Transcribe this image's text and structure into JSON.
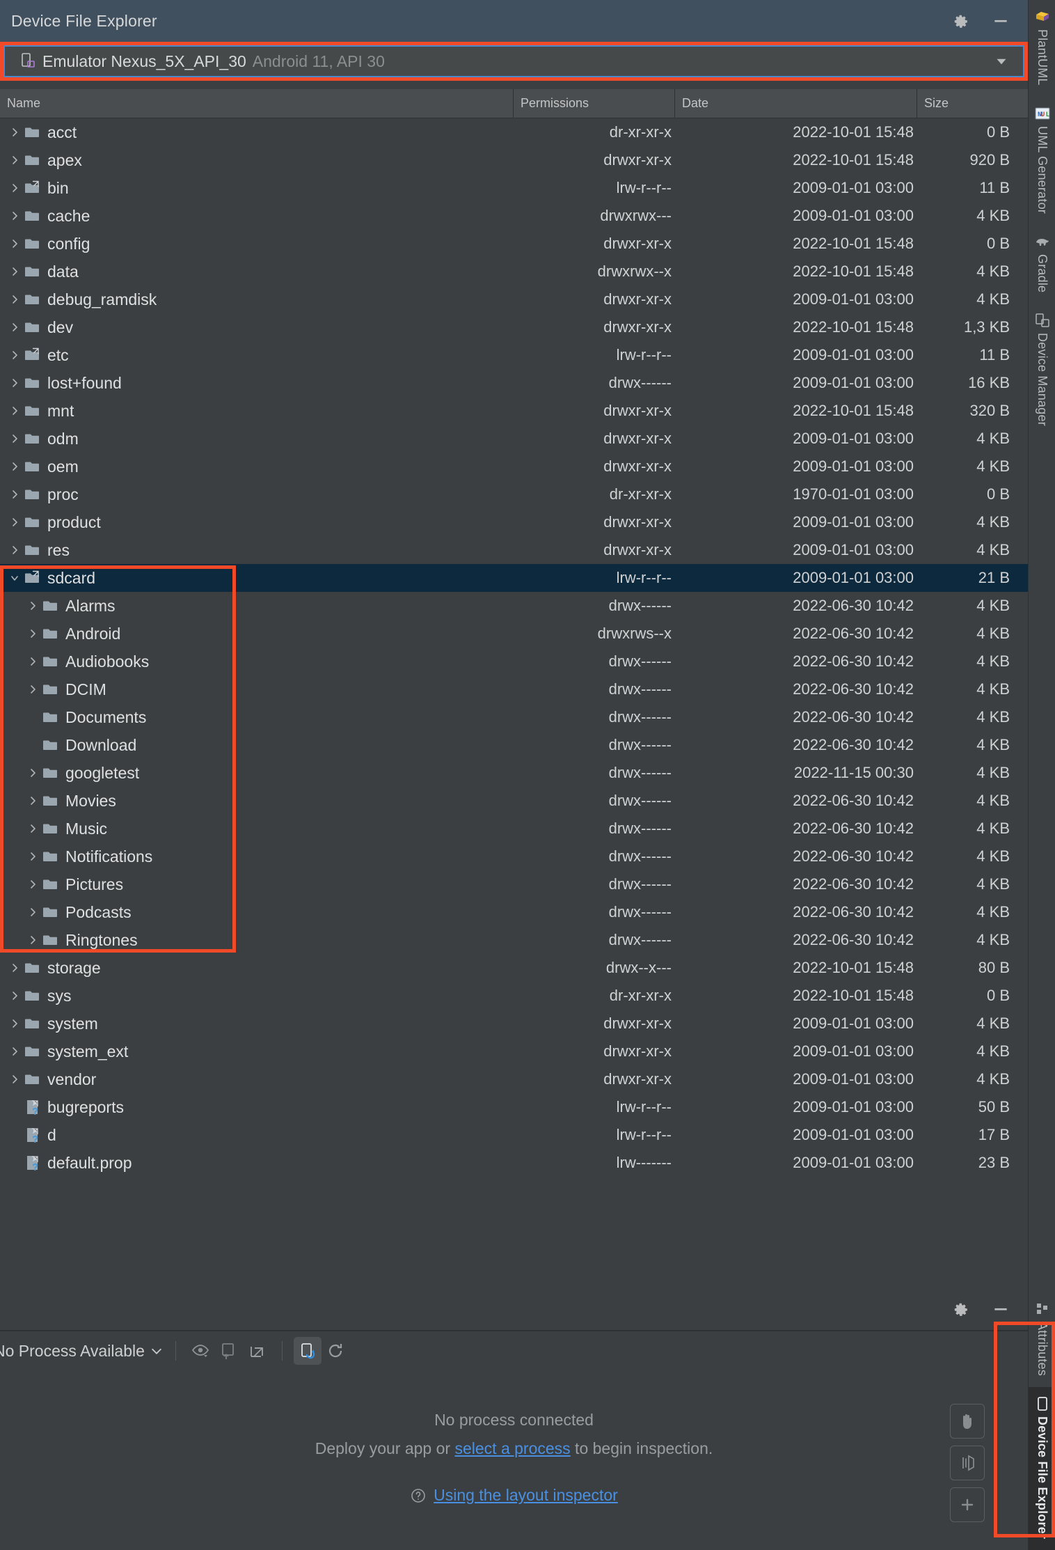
{
  "window": {
    "title": "Device File Explorer",
    "settings_icon": "gear-icon",
    "minimize_icon": "minimize-icon"
  },
  "device_selector": {
    "icon": "device-phone-icon",
    "name": "Emulator Nexus_5X_API_30",
    "subtitle": "Android 11, API 30",
    "caret_icon": "chevron-down-icon"
  },
  "table": {
    "columns": [
      "Name",
      "Permissions",
      "Date",
      "Size"
    ],
    "rows": [
      {
        "name": "acct",
        "indent": 0,
        "twisty": "collapsed",
        "icon": "folder",
        "permissions": "dr-xr-xr-x",
        "date": "2022-10-01 15:48",
        "size": "0 B",
        "selected": false
      },
      {
        "name": "apex",
        "indent": 0,
        "twisty": "collapsed",
        "icon": "folder",
        "permissions": "drwxr-xr-x",
        "date": "2022-10-01 15:48",
        "size": "920 B",
        "selected": false
      },
      {
        "name": "bin",
        "indent": 0,
        "twisty": "collapsed",
        "icon": "folder-link",
        "permissions": "lrw-r--r--",
        "date": "2009-01-01 03:00",
        "size": "11 B",
        "selected": false
      },
      {
        "name": "cache",
        "indent": 0,
        "twisty": "collapsed",
        "icon": "folder",
        "permissions": "drwxrwx---",
        "date": "2009-01-01 03:00",
        "size": "4 KB",
        "selected": false
      },
      {
        "name": "config",
        "indent": 0,
        "twisty": "collapsed",
        "icon": "folder",
        "permissions": "drwxr-xr-x",
        "date": "2022-10-01 15:48",
        "size": "0 B",
        "selected": false
      },
      {
        "name": "data",
        "indent": 0,
        "twisty": "collapsed",
        "icon": "folder",
        "permissions": "drwxrwx--x",
        "date": "2022-10-01 15:48",
        "size": "4 KB",
        "selected": false
      },
      {
        "name": "debug_ramdisk",
        "indent": 0,
        "twisty": "collapsed",
        "icon": "folder",
        "permissions": "drwxr-xr-x",
        "date": "2009-01-01 03:00",
        "size": "4 KB",
        "selected": false
      },
      {
        "name": "dev",
        "indent": 0,
        "twisty": "collapsed",
        "icon": "folder",
        "permissions": "drwxr-xr-x",
        "date": "2022-10-01 15:48",
        "size": "1,3 KB",
        "selected": false
      },
      {
        "name": "etc",
        "indent": 0,
        "twisty": "collapsed",
        "icon": "folder-link",
        "permissions": "lrw-r--r--",
        "date": "2009-01-01 03:00",
        "size": "11 B",
        "selected": false
      },
      {
        "name": "lost+found",
        "indent": 0,
        "twisty": "collapsed",
        "icon": "folder",
        "permissions": "drwx------",
        "date": "2009-01-01 03:00",
        "size": "16 KB",
        "selected": false
      },
      {
        "name": "mnt",
        "indent": 0,
        "twisty": "collapsed",
        "icon": "folder",
        "permissions": "drwxr-xr-x",
        "date": "2022-10-01 15:48",
        "size": "320 B",
        "selected": false
      },
      {
        "name": "odm",
        "indent": 0,
        "twisty": "collapsed",
        "icon": "folder",
        "permissions": "drwxr-xr-x",
        "date": "2009-01-01 03:00",
        "size": "4 KB",
        "selected": false
      },
      {
        "name": "oem",
        "indent": 0,
        "twisty": "collapsed",
        "icon": "folder",
        "permissions": "drwxr-xr-x",
        "date": "2009-01-01 03:00",
        "size": "4 KB",
        "selected": false
      },
      {
        "name": "proc",
        "indent": 0,
        "twisty": "collapsed",
        "icon": "folder",
        "permissions": "dr-xr-xr-x",
        "date": "1970-01-01 03:00",
        "size": "0 B",
        "selected": false
      },
      {
        "name": "product",
        "indent": 0,
        "twisty": "collapsed",
        "icon": "folder",
        "permissions": "drwxr-xr-x",
        "date": "2009-01-01 03:00",
        "size": "4 KB",
        "selected": false
      },
      {
        "name": "res",
        "indent": 0,
        "twisty": "collapsed",
        "icon": "folder",
        "permissions": "drwxr-xr-x",
        "date": "2009-01-01 03:00",
        "size": "4 KB",
        "selected": false
      },
      {
        "name": "sdcard",
        "indent": 0,
        "twisty": "expanded",
        "icon": "folder-link",
        "permissions": "lrw-r--r--",
        "date": "2009-01-01 03:00",
        "size": "21 B",
        "selected": true
      },
      {
        "name": "Alarms",
        "indent": 1,
        "twisty": "collapsed",
        "icon": "folder",
        "permissions": "drwx------",
        "date": "2022-06-30 10:42",
        "size": "4 KB",
        "selected": false
      },
      {
        "name": "Android",
        "indent": 1,
        "twisty": "collapsed",
        "icon": "folder",
        "permissions": "drwxrws--x",
        "date": "2022-06-30 10:42",
        "size": "4 KB",
        "selected": false
      },
      {
        "name": "Audiobooks",
        "indent": 1,
        "twisty": "collapsed",
        "icon": "folder",
        "permissions": "drwx------",
        "date": "2022-06-30 10:42",
        "size": "4 KB",
        "selected": false
      },
      {
        "name": "DCIM",
        "indent": 1,
        "twisty": "collapsed",
        "icon": "folder",
        "permissions": "drwx------",
        "date": "2022-06-30 10:42",
        "size": "4 KB",
        "selected": false
      },
      {
        "name": "Documents",
        "indent": 1,
        "twisty": "none",
        "icon": "folder",
        "permissions": "drwx------",
        "date": "2022-06-30 10:42",
        "size": "4 KB",
        "selected": false
      },
      {
        "name": "Download",
        "indent": 1,
        "twisty": "none",
        "icon": "folder",
        "permissions": "drwx------",
        "date": "2022-06-30 10:42",
        "size": "4 KB",
        "selected": false
      },
      {
        "name": "googletest",
        "indent": 1,
        "twisty": "collapsed",
        "icon": "folder",
        "permissions": "drwx------",
        "date": "2022-11-15 00:30",
        "size": "4 KB",
        "selected": false
      },
      {
        "name": "Movies",
        "indent": 1,
        "twisty": "collapsed",
        "icon": "folder",
        "permissions": "drwx------",
        "date": "2022-06-30 10:42",
        "size": "4 KB",
        "selected": false
      },
      {
        "name": "Music",
        "indent": 1,
        "twisty": "collapsed",
        "icon": "folder",
        "permissions": "drwx------",
        "date": "2022-06-30 10:42",
        "size": "4 KB",
        "selected": false
      },
      {
        "name": "Notifications",
        "indent": 1,
        "twisty": "collapsed",
        "icon": "folder",
        "permissions": "drwx------",
        "date": "2022-06-30 10:42",
        "size": "4 KB",
        "selected": false
      },
      {
        "name": "Pictures",
        "indent": 1,
        "twisty": "collapsed",
        "icon": "folder",
        "permissions": "drwx------",
        "date": "2022-06-30 10:42",
        "size": "4 KB",
        "selected": false
      },
      {
        "name": "Podcasts",
        "indent": 1,
        "twisty": "collapsed",
        "icon": "folder",
        "permissions": "drwx------",
        "date": "2022-06-30 10:42",
        "size": "4 KB",
        "selected": false
      },
      {
        "name": "Ringtones",
        "indent": 1,
        "twisty": "collapsed",
        "icon": "folder",
        "permissions": "drwx------",
        "date": "2022-06-30 10:42",
        "size": "4 KB",
        "selected": false
      },
      {
        "name": "storage",
        "indent": 0,
        "twisty": "collapsed",
        "icon": "folder",
        "permissions": "drwx--x---",
        "date": "2022-10-01 15:48",
        "size": "80 B",
        "selected": false
      },
      {
        "name": "sys",
        "indent": 0,
        "twisty": "collapsed",
        "icon": "folder",
        "permissions": "dr-xr-xr-x",
        "date": "2022-10-01 15:48",
        "size": "0 B",
        "selected": false
      },
      {
        "name": "system",
        "indent": 0,
        "twisty": "collapsed",
        "icon": "folder",
        "permissions": "drwxr-xr-x",
        "date": "2009-01-01 03:00",
        "size": "4 KB",
        "selected": false
      },
      {
        "name": "system_ext",
        "indent": 0,
        "twisty": "collapsed",
        "icon": "folder",
        "permissions": "drwxr-xr-x",
        "date": "2009-01-01 03:00",
        "size": "4 KB",
        "selected": false
      },
      {
        "name": "vendor",
        "indent": 0,
        "twisty": "collapsed",
        "icon": "folder",
        "permissions": "drwxr-xr-x",
        "date": "2009-01-01 03:00",
        "size": "4 KB",
        "selected": false
      },
      {
        "name": "bugreports",
        "indent": 0,
        "twisty": "none",
        "icon": "file-link",
        "permissions": "lrw-r--r--",
        "date": "2009-01-01 03:00",
        "size": "50 B",
        "selected": false
      },
      {
        "name": "d",
        "indent": 0,
        "twisty": "none",
        "icon": "file-link",
        "permissions": "lrw-r--r--",
        "date": "2009-01-01 03:00",
        "size": "17 B",
        "selected": false
      },
      {
        "name": "default.prop",
        "indent": 0,
        "twisty": "none",
        "icon": "file-link",
        "permissions": "lrw-------",
        "date": "2009-01-01 03:00",
        "size": "23 B",
        "selected": false
      }
    ]
  },
  "inspector": {
    "settings_icon": "gear-icon",
    "minimize_icon": "minimize-icon",
    "process_selector": "No Process Available",
    "toolbar_icons": [
      "eye-dropdown-icon",
      "load-snapshot-icon",
      "export-snapshot-icon",
      "live-updates-icon",
      "refresh-icon"
    ],
    "empty_title": "No process connected",
    "empty_line_prefix": "Deploy your app or ",
    "empty_line_link": "select a process",
    "empty_line_suffix": " to begin inspection.",
    "help_link": "Using the layout inspector",
    "fab_icons": [
      "pan-hand-icon",
      "layers-3d-icon",
      "zoom-in-icon"
    ]
  },
  "right_rail": {
    "top_items": [
      {
        "label": "PlantUML",
        "icon": "plantuml-icon"
      },
      {
        "label": "UML Generator",
        "icon": "uml-generator-icon"
      },
      {
        "label": "Gradle",
        "icon": "gradle-elephant-icon"
      },
      {
        "label": "Device Manager",
        "icon": "device-manager-icon"
      }
    ],
    "bottom_items": [
      {
        "label": "Attributes",
        "icon": "attributes-icon",
        "active": false
      },
      {
        "label": "Device File Explorer",
        "icon": "device-phone-icon",
        "active": true
      }
    ]
  },
  "highlights": {
    "color": "#f04a28",
    "boxes": [
      "device-selector",
      "sdcard-subtree",
      "device-file-explorer-rail"
    ]
  }
}
